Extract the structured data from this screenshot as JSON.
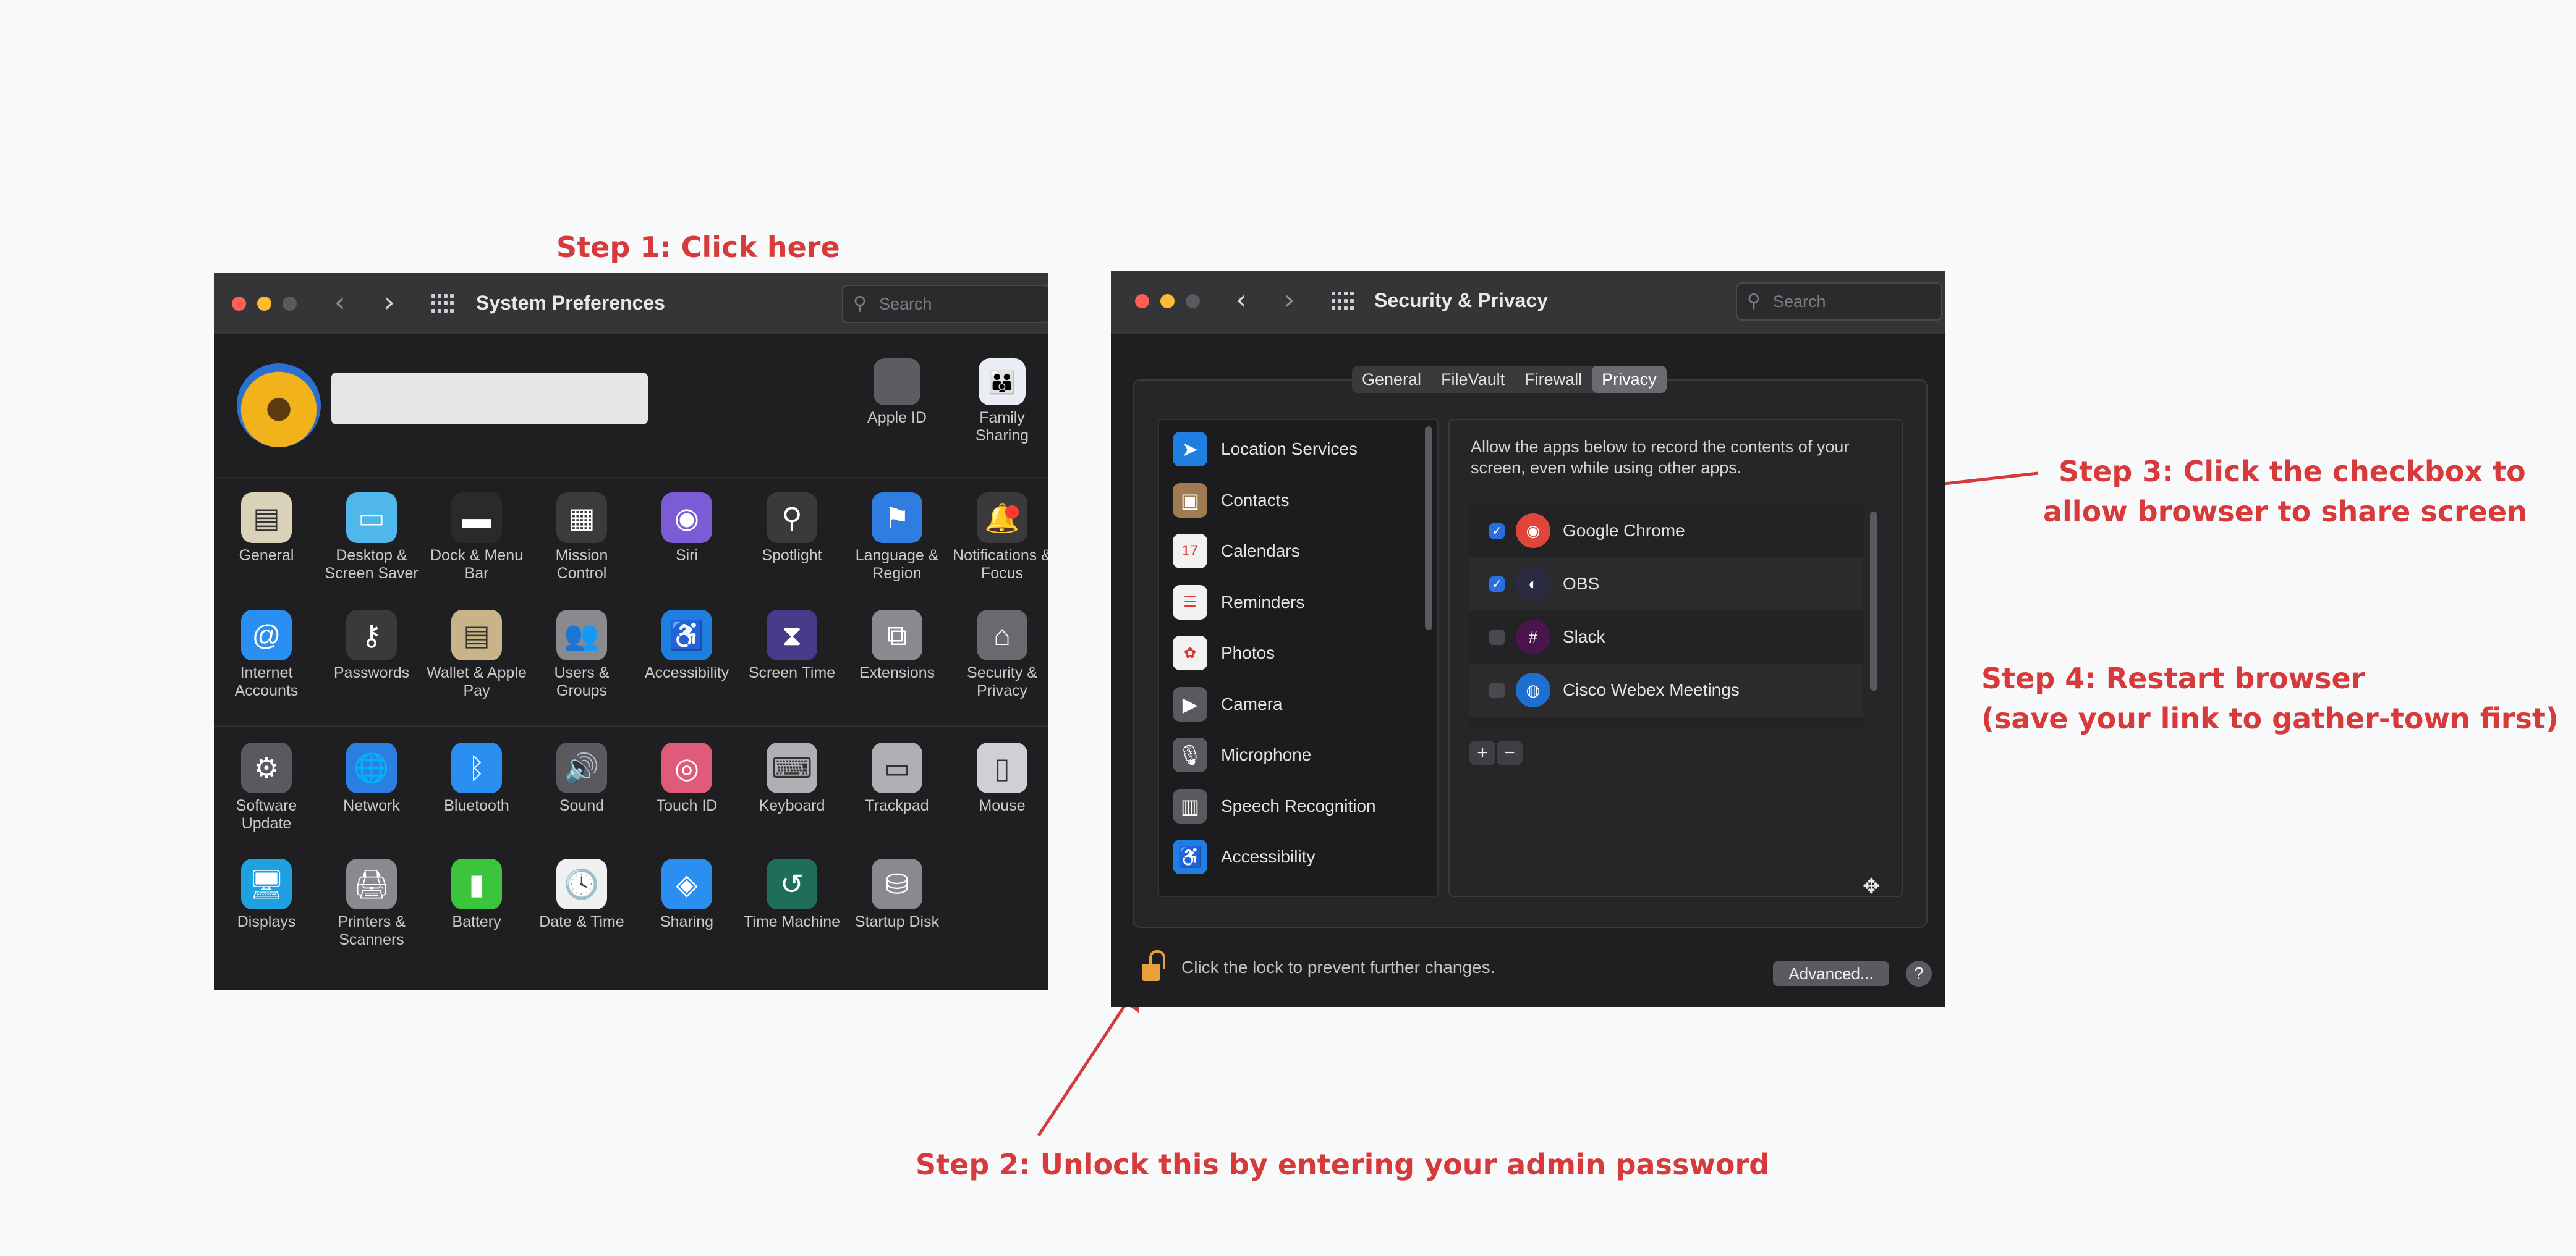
{
  "annotations": {
    "step1": "Step 1: Click here",
    "step2": "Step 2: Unlock this by entering your admin password",
    "step3_line1": "Step 3: Click the checkbox to",
    "step3_line2": "allow browser to share screen",
    "step4_line1": "Step 4: Restart browser",
    "step4_line2": "(save your link to gather-town first)"
  },
  "colors": {
    "annotation": "#d63a3a",
    "close": "#ff5f57",
    "minimize": "#febc2e",
    "checkbox_on": "#2a6fe0"
  },
  "system_prefs": {
    "title": "System Preferences",
    "search_placeholder": "Search",
    "top_right": [
      {
        "label": "Apple ID",
        "icon": "apple-id-icon",
        "glyph": ""
      },
      {
        "label": "Family Sharing",
        "icon": "family-sharing-icon",
        "glyph": "👪"
      }
    ],
    "row1": [
      {
        "label": "General",
        "icon": "general-icon",
        "glyph": "▤",
        "color": "#d9d2b8"
      },
      {
        "label": "Desktop & Screen Saver",
        "icon": "desktop-icon",
        "glyph": "▭",
        "color": "#4fb7ea"
      },
      {
        "label": "Dock & Menu Bar",
        "icon": "dock-icon",
        "glyph": "▬",
        "color": "#2a2a2a"
      },
      {
        "label": "Mission Control",
        "icon": "mission-control-icon",
        "glyph": "▦",
        "color": "#3b3b3e"
      },
      {
        "label": "Siri",
        "icon": "siri-icon",
        "glyph": "◉",
        "color": "#7b5cd6"
      },
      {
        "label": "Spotlight",
        "icon": "spotlight-icon",
        "glyph": "⚲",
        "color": "#3a3a3d"
      },
      {
        "label": "Language & Region",
        "icon": "language-region-icon",
        "glyph": "⚑",
        "color": "#2f7de0"
      },
      {
        "label": "Notifications & Focus",
        "icon": "notifications-icon",
        "glyph": "🔔",
        "color": "#3a3a3d"
      }
    ],
    "row2": [
      {
        "label": "Internet Accounts",
        "icon": "internet-accounts-icon",
        "glyph": "@",
        "color": "#2a8ff0"
      },
      {
        "label": "Passwords",
        "icon": "passwords-icon",
        "glyph": "⚷",
        "color": "#3a3a3d"
      },
      {
        "label": "Wallet & Apple Pay",
        "icon": "wallet-icon",
        "glyph": "▤",
        "color": "#c9b48a"
      },
      {
        "label": "Users & Groups",
        "icon": "users-groups-icon",
        "glyph": "👥",
        "color": "#8a8a8e"
      },
      {
        "label": "Accessibility",
        "icon": "accessibility-icon",
        "glyph": "♿",
        "color": "#1f7fe0"
      },
      {
        "label": "Screen Time",
        "icon": "screen-time-icon",
        "glyph": "⧗",
        "color": "#4a3a8a"
      },
      {
        "label": "Extensions",
        "icon": "extensions-icon",
        "glyph": "⧉",
        "color": "#8a8a8e"
      },
      {
        "label": "Security & Privacy",
        "icon": "security-privacy-icon",
        "glyph": "⌂",
        "color": "#6a6a6e"
      }
    ],
    "row3": [
      {
        "label": "Software Update",
        "icon": "software-update-icon",
        "glyph": "⚙",
        "color": "#5a5a5e"
      },
      {
        "label": "Network",
        "icon": "network-icon",
        "glyph": "🌐",
        "color": "#2a7fe0"
      },
      {
        "label": "Bluetooth",
        "icon": "bluetooth-icon",
        "glyph": "ᛒ",
        "color": "#2a8ff0"
      },
      {
        "label": "Sound",
        "icon": "sound-icon",
        "glyph": "🔊",
        "color": "#5a5a5e"
      },
      {
        "label": "Touch ID",
        "icon": "touch-id-icon",
        "glyph": "◎",
        "color": "#e05a7a"
      },
      {
        "label": "Keyboard",
        "icon": "keyboard-icon",
        "glyph": "⌨",
        "color": "#b0b0b4"
      },
      {
        "label": "Trackpad",
        "icon": "trackpad-icon",
        "glyph": "▭",
        "color": "#b0b0b4"
      },
      {
        "label": "Mouse",
        "icon": "mouse-icon",
        "glyph": "▯",
        "color": "#d0d0d4"
      }
    ],
    "row4": [
      {
        "label": "Displays",
        "icon": "displays-icon",
        "glyph": "🖥",
        "color": "#1fa0e0"
      },
      {
        "label": "Printers & Scanners",
        "icon": "printers-icon",
        "glyph": "🖨",
        "color": "#8a8a8e"
      },
      {
        "label": "Battery",
        "icon": "battery-icon",
        "glyph": "▮",
        "color": "#3cc43c"
      },
      {
        "label": "Date & Time",
        "icon": "date-time-icon",
        "glyph": "🕓",
        "color": "#f0f0f0"
      },
      {
        "label": "Sharing",
        "icon": "sharing-icon",
        "glyph": "◈",
        "color": "#2a8ff0"
      },
      {
        "label": "Time Machine",
        "icon": "time-machine-icon",
        "glyph": "↺",
        "color": "#1f6e5a"
      },
      {
        "label": "Startup Disk",
        "icon": "startup-disk-icon",
        "glyph": "⛁",
        "color": "#8a8a8e"
      }
    ]
  },
  "security": {
    "title": "Security & Privacy",
    "search_placeholder": "Search",
    "tabs": [
      {
        "label": "General",
        "selected": false
      },
      {
        "label": "FileVault",
        "selected": false
      },
      {
        "label": "Firewall",
        "selected": false
      },
      {
        "label": "Privacy",
        "selected": true
      }
    ],
    "sidebar": [
      {
        "label": "Location Services",
        "icon": "location-icon",
        "glyph": "➤",
        "color": "#1f7fe0"
      },
      {
        "label": "Contacts",
        "icon": "contacts-icon",
        "glyph": "▣",
        "color": "#a07a50"
      },
      {
        "label": "Calendars",
        "icon": "calendars-icon",
        "glyph": "17",
        "color": "#f2f2f2"
      },
      {
        "label": "Reminders",
        "icon": "reminders-icon",
        "glyph": "☰",
        "color": "#f2f2f2"
      },
      {
        "label": "Photos",
        "icon": "photos-icon",
        "glyph": "✿",
        "color": "#f2f2f2"
      },
      {
        "label": "Camera",
        "icon": "camera-icon",
        "glyph": "▶",
        "color": "#5a5a5e"
      },
      {
        "label": "Microphone",
        "icon": "microphone-icon",
        "glyph": "🎙",
        "color": "#5a5a5e"
      },
      {
        "label": "Speech Recognition",
        "icon": "speech-icon",
        "glyph": "▥",
        "color": "#5a5a5e"
      },
      {
        "label": "Accessibility",
        "icon": "accessibility-icon",
        "glyph": "♿",
        "color": "#1f7fe0"
      }
    ],
    "description": "Allow the apps below to record the contents of your screen, even while using other apps.",
    "apps": [
      {
        "name": "Google Chrome",
        "checked": true,
        "icon": "chrome-icon",
        "glyph": "◉",
        "color": "#e0453a"
      },
      {
        "name": "OBS",
        "checked": true,
        "icon": "obs-icon",
        "glyph": "◐",
        "color": "#2a2a40"
      },
      {
        "name": "Slack",
        "checked": false,
        "icon": "slack-icon",
        "glyph": "#",
        "color": "#4a154b"
      },
      {
        "name": "Cisco Webex Meetings",
        "checked": false,
        "icon": "webex-icon",
        "glyph": "◍",
        "color": "#1f6fd0"
      }
    ],
    "add_label": "+",
    "remove_label": "−",
    "lock_text": "Click the lock to prevent further changes.",
    "advanced_label": "Advanced...",
    "help_label": "?"
  }
}
